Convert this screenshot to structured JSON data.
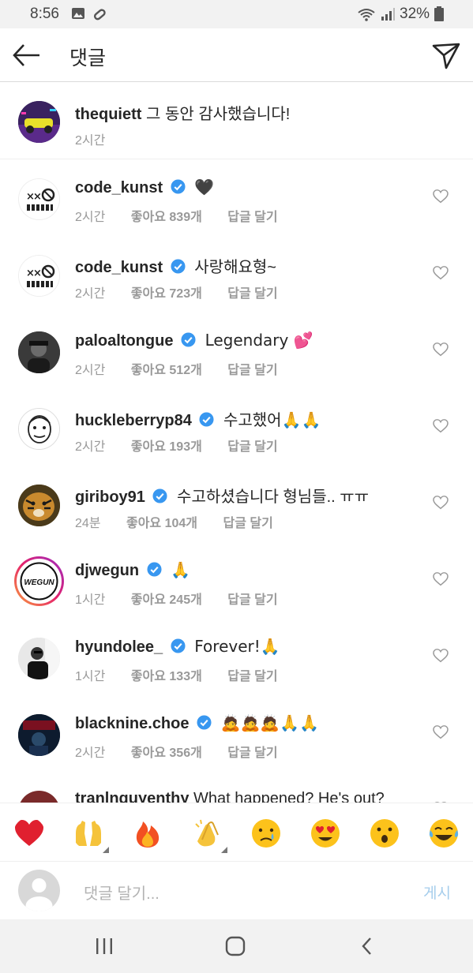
{
  "status": {
    "time": "8:56",
    "battery": "32%"
  },
  "header": {
    "title": "댓글"
  },
  "caption": {
    "username": "thequiett",
    "text": "그 동안 감사했습니다!",
    "time": "2시간"
  },
  "comments": [
    {
      "username": "code_kunst",
      "verified": true,
      "text": "🖤",
      "time": "2시간",
      "likes": "좋아요 839개",
      "reply": "답글 달기"
    },
    {
      "username": "code_kunst",
      "verified": true,
      "text": "사랑해요형~",
      "time": "2시간",
      "likes": "좋아요 723개",
      "reply": "답글 달기"
    },
    {
      "username": "paloaltongue",
      "verified": true,
      "text": "Legendary 💕",
      "time": "2시간",
      "likes": "좋아요 512개",
      "reply": "답글 달기"
    },
    {
      "username": "huckleberryp84",
      "verified": true,
      "text": "수고했어🙏🙏",
      "time": "2시간",
      "likes": "좋아요 193개",
      "reply": "답글 달기"
    },
    {
      "username": "giriboy91",
      "verified": true,
      "text": "수고하셨습니다 형님들.. ㅠㅠ",
      "time": "24분",
      "likes": "좋아요 104개",
      "reply": "답글 달기"
    },
    {
      "username": "djwegun",
      "verified": true,
      "text": "🙏",
      "time": "1시간",
      "likes": "좋아요 245개",
      "reply": "답글 달기"
    },
    {
      "username": "hyundolee_",
      "verified": true,
      "text": "Forever!🙏",
      "time": "1시간",
      "likes": "좋아요 133개",
      "reply": "답글 달기"
    },
    {
      "username": "blacknine.choe",
      "verified": true,
      "text": "🙇🙇🙇🙏🙏",
      "time": "2시간",
      "likes": "좋아요 356개",
      "reply": "답글 달기"
    },
    {
      "username": "tranlnguyenthy",
      "verified": false,
      "text": "What happened? He's out?",
      "time": "",
      "likes": "",
      "reply": ""
    }
  ],
  "reactions": [
    "❤",
    "🙌",
    "🔥",
    "👏",
    "😢",
    "😍",
    "😮",
    "😂"
  ],
  "reaction_icons": [
    "heart",
    "raised-hands",
    "fire",
    "clapping-hands",
    "crying-face",
    "heart-eyes-face",
    "surprised-face",
    "tears-of-joy-face"
  ],
  "input": {
    "placeholder": "댓글 달기...",
    "post_label": "게시"
  },
  "colors": {
    "verified": "#3897f0",
    "post_disabled": "#a5cdec",
    "meta_text": "#999999"
  }
}
